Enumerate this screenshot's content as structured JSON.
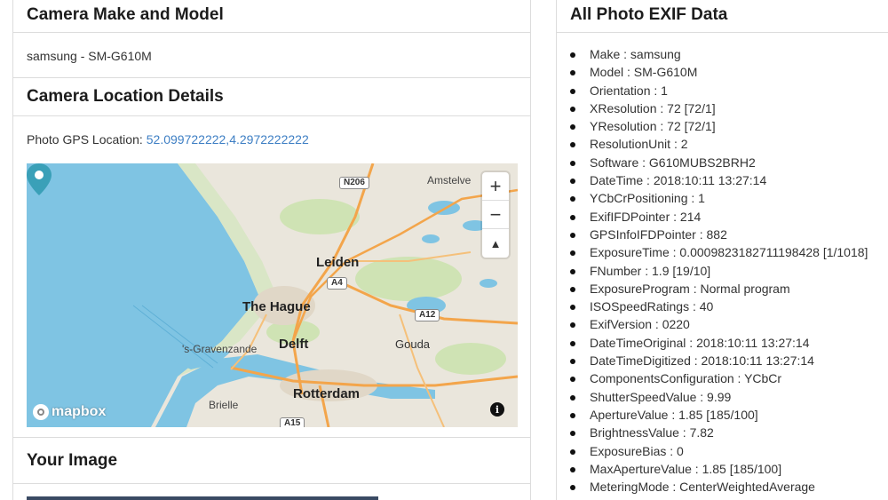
{
  "make_card": {
    "title": "Camera Make and Model",
    "value": "samsung - SM-G610M"
  },
  "location_card": {
    "title": "Camera Location Details",
    "gps_label": "Photo GPS Location:",
    "gps_value": "52.099722222,4.2972222222",
    "map": {
      "labels": {
        "amstelveen": "Amstelve",
        "leiden": "Leiden",
        "the_hague": "The Hague",
        "delft": "Delft",
        "gravenzande": "'s-Gravenzande",
        "gouda": "Gouda",
        "rotterdam": "Rotterdam",
        "brielle": "Brielle"
      },
      "shields": {
        "n206": "N206",
        "a4": "A4",
        "a12": "A12",
        "a15": "A15"
      },
      "zoom_in": "+",
      "zoom_out": "−",
      "compass": "▲",
      "logo": "mapbox",
      "info": "i",
      "colors": {
        "water": "#7fc4e3",
        "land": "#eae6dc",
        "green": "#cfe3b4",
        "road": "#f3a54b",
        "pin": "#3aa0b8"
      }
    }
  },
  "image_card": {
    "title": "Your Image"
  },
  "exif_card": {
    "title": "All Photo EXIF Data",
    "items": [
      "Make : samsung",
      "Model : SM-G610M",
      "Orientation : 1",
      "XResolution : 72 [72/1]",
      "YResolution : 72 [72/1]",
      "ResolutionUnit : 2",
      "Software : G610MUBS2BRH2",
      "DateTime : 2018:10:11 13:27:14",
      "YCbCrPositioning : 1",
      "ExifIFDPointer : 214",
      "GPSInfoIFDPointer : 882",
      "ExposureTime : 0.0009823182711198428 [1/1018]",
      "FNumber : 1.9 [19/10]",
      "ExposureProgram : Normal program",
      "ISOSpeedRatings : 40",
      "ExifVersion : 0220",
      "DateTimeOriginal : 2018:10:11 13:27:14",
      "DateTimeDigitized : 2018:10:11 13:27:14",
      "ComponentsConfiguration : YCbCr",
      "ShutterSpeedValue : 9.99",
      "ApertureValue : 1.85 [185/100]",
      "BrightnessValue : 7.82",
      "ExposureBias : 0",
      "MaxApertureValue : 1.85 [185/100]",
      "MeteringMode : CenterWeightedAverage"
    ]
  }
}
